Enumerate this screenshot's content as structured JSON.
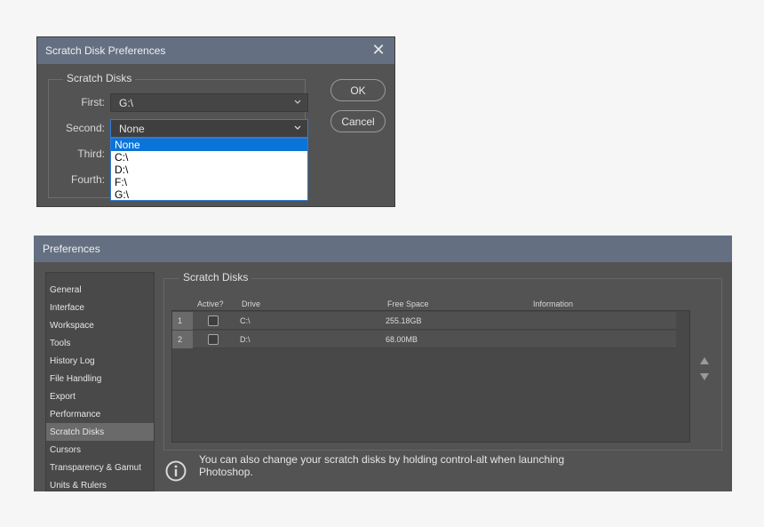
{
  "scratch_dialog": {
    "title": "Scratch Disk Preferences",
    "group_title": "Scratch Disks",
    "rows": [
      {
        "label": "First:",
        "value": "G:\\"
      },
      {
        "label": "Second:",
        "value": "None"
      },
      {
        "label": "Third:",
        "value": ""
      },
      {
        "label": "Fourth:",
        "value": ""
      }
    ],
    "dropdown_options": [
      "None",
      "C:\\",
      "D:\\",
      "F:\\",
      "G:\\"
    ],
    "dropdown_selected": "None",
    "ok_label": "OK",
    "cancel_label": "Cancel"
  },
  "preferences": {
    "title": "Preferences",
    "sidebar": [
      "General",
      "Interface",
      "Workspace",
      "Tools",
      "History Log",
      "File Handling",
      "Export",
      "Performance",
      "Scratch Disks",
      "Cursors",
      "Transparency & Gamut",
      "Units & Rulers"
    ],
    "active_item": "Scratch Disks",
    "group_title": "Scratch Disks",
    "columns": [
      "Active?",
      "Drive",
      "Free Space",
      "Information"
    ],
    "disks": [
      {
        "num": "1",
        "drive": "C:\\",
        "free": "255.18GB",
        "info": "",
        "active": false
      },
      {
        "num": "2",
        "drive": "D:\\",
        "free": "68.00MB",
        "info": "",
        "active": false
      }
    ],
    "info_text": "You can also change your scratch disks by holding control-alt when launching Photoshop."
  },
  "colors": {
    "title_bar": "#647082",
    "dialog_bg": "#535353",
    "selection": "#0a74d8"
  }
}
